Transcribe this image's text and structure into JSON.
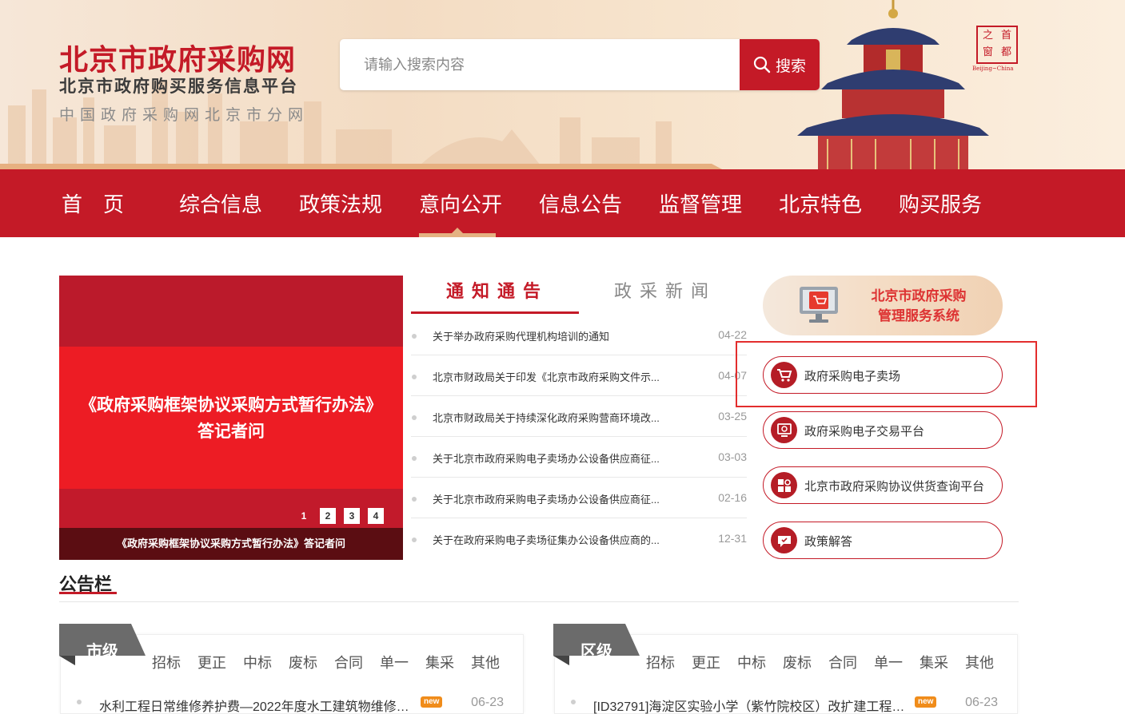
{
  "header": {
    "title": "北京市政府采购网",
    "subtitle": "北京市政府购买服务信息平台",
    "subtitle2": "中国政府采购网北京市分网",
    "search_placeholder": "请输入搜索内容",
    "search_button": "搜索",
    "seal_chars": [
      "首",
      "之",
      "都",
      "窗"
    ],
    "seal_caption": "Beijing~China"
  },
  "nav": {
    "items": [
      "首　页",
      "综合信息",
      "政策法规",
      "意向公开",
      "信息公告",
      "监督管理",
      "北京特色",
      "购买服务"
    ],
    "active": "意向公开"
  },
  "carousel": {
    "heading_line1": "《政府采购框架协议采购方式暂行办法》",
    "heading_line2": "答记者问",
    "caption": "《政府采购框架协议采购方式暂行办法》答记者问",
    "pages": [
      "1",
      "2",
      "3",
      "4"
    ],
    "active_page": "1"
  },
  "notices": {
    "tabs": [
      "通知通告",
      "政采新闻"
    ],
    "items": [
      {
        "title": "关于举办政府采购代理机构培训的通知",
        "date": "04-22"
      },
      {
        "title": "北京市财政局关于印发《北京市政府采购文件示...",
        "date": "04-07"
      },
      {
        "title": "北京市财政局关于持续深化政府采购营商环境改...",
        "date": "03-25"
      },
      {
        "title": "关于北京市政府采购电子卖场办公设备供应商征...",
        "date": "03-03"
      },
      {
        "title": "关于北京市政府采购电子卖场办公设备供应商征...",
        "date": "02-16"
      },
      {
        "title": "关于在政府采购电子卖场征集办公设备供应商的...",
        "date": "12-31"
      }
    ]
  },
  "side": {
    "system_line1": "北京市政府采购",
    "system_line2": "管理服务系统",
    "links": [
      {
        "label": "政府采购电子卖场",
        "icon": "cart-icon"
      },
      {
        "label": "政府采购电子交易平台",
        "icon": "trade-platform-icon"
      },
      {
        "label": "北京市政府采购协议供货查询平台",
        "icon": "query-icon"
      },
      {
        "label": "政策解答",
        "icon": "chat-icon"
      }
    ]
  },
  "board": {
    "title": "公告栏",
    "panels": [
      {
        "tag": "市级",
        "categories": [
          "招标",
          "更正",
          "中标",
          "废标",
          "合同",
          "单一",
          "集采",
          "其他"
        ],
        "row": {
          "title": "水利工程日常维修养护费—2022年度水工建筑物维修养...",
          "badge": "new",
          "date": "06-23"
        }
      },
      {
        "tag": "区级",
        "categories": [
          "招标",
          "更正",
          "中标",
          "废标",
          "合同",
          "单一",
          "集采",
          "其他"
        ],
        "row": {
          "title": "[ID32791]海淀区实验小学（紫竹院校区）改扩建工程配...",
          "badge": "new",
          "date": "06-23"
        }
      }
    ]
  },
  "colors": {
    "brand_red": "#c41a27",
    "gold": "#e4b282",
    "carousel_red": "#ed1c24"
  }
}
